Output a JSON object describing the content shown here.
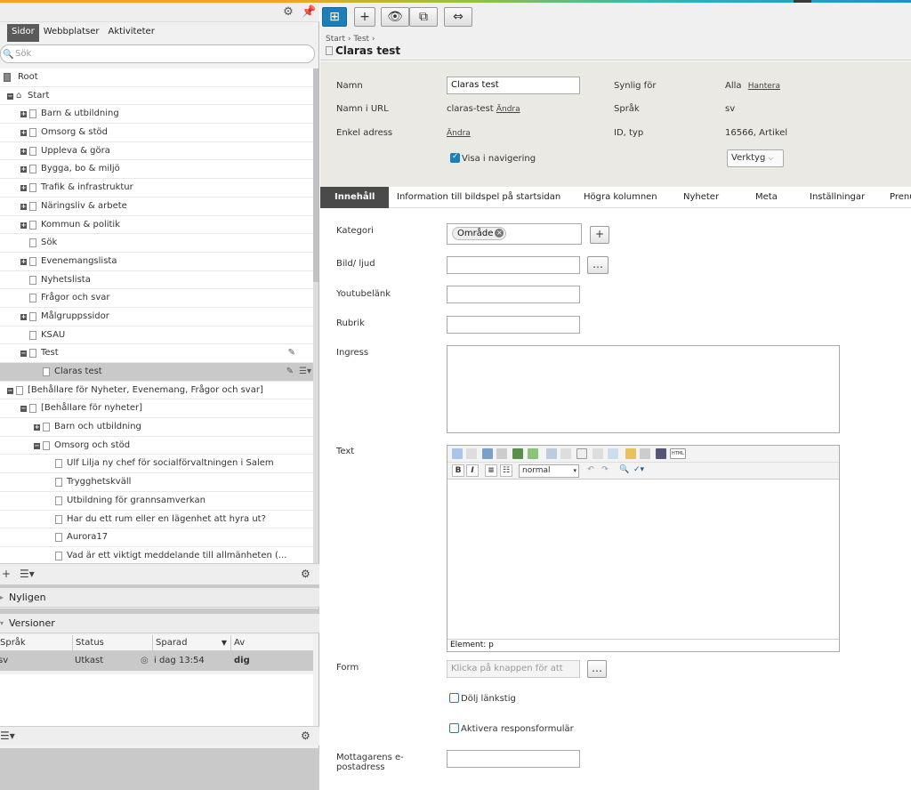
{
  "tree_panel": {
    "tabs": [
      "Sidor",
      "Webbplatser",
      "Aktiviteter"
    ],
    "search_placeholder": "Sök",
    "nodes": [
      {
        "label": "Root",
        "icon": "root-icon"
      },
      {
        "label": "Start",
        "icon": "home-icon"
      },
      {
        "label": "Barn & utbildning"
      },
      {
        "label": "Omsorg & stöd"
      },
      {
        "label": "Uppleva & göra"
      },
      {
        "label": "Bygga, bo & miljö"
      },
      {
        "label": "Trafik & infrastruktur"
      },
      {
        "label": "Näringsliv & arbete"
      },
      {
        "label": "Kommun & politik"
      },
      {
        "label": "Sök"
      },
      {
        "label": "Evenemangslista"
      },
      {
        "label": "Nyhetslista"
      },
      {
        "label": "Frågor och svar"
      },
      {
        "label": "Målgruppssidor"
      },
      {
        "label": "KSAU"
      },
      {
        "label": "Test"
      },
      {
        "label": "Claras test",
        "selected": true
      },
      {
        "label": "[Behållare för Nyheter, Evenemang, Frågor och svar]"
      },
      {
        "label": "[Behållare för nyheter]"
      },
      {
        "label": "Barn och utbildning"
      },
      {
        "label": "Omsorg och stöd"
      },
      {
        "label": "Ulf Lilja ny chef för socialförvaltningen i Salem"
      },
      {
        "label": "Trygghetskväll"
      },
      {
        "label": "Utbildning för grannsamverkan"
      },
      {
        "label": "Har du ett rum eller en lägenhet att hyra ut?"
      },
      {
        "label": "Aurora17"
      },
      {
        "label": "Vad är ett viktigt meddelande till allmänheten (..."
      }
    ]
  },
  "recent_panel": {
    "title": "Nyligen"
  },
  "versions_panel": {
    "title": "Versioner",
    "columns": [
      "Språk",
      "Status",
      "Sparad",
      "Av"
    ],
    "rows": [
      {
        "lang": "sv",
        "status": "Utkast",
        "saved": "i dag 13:54",
        "by": "dig"
      }
    ]
  },
  "breadcrumb": [
    "Start",
    "Test"
  ],
  "page_title": "Claras test",
  "properties": {
    "name_label": "Namn",
    "name_value": "Claras test",
    "url_label": "Namn i URL",
    "url_value": "claras-test",
    "change_link": "Ändra",
    "simple_label": "Enkel adress",
    "visible_label": "Synlig för",
    "visible_value": "Alla",
    "manage_link": "Hantera",
    "lang_label": "Språk",
    "lang_value": "sv",
    "id_label": "ID, typ",
    "id_value": "16566, Artikel",
    "show_in_nav": "Visa i navigering",
    "tools_button": "Verktyg"
  },
  "content_tabs": [
    "Innehåll",
    "Information till bildspel på startsidan",
    "Högra kolumnen",
    "Nyheter",
    "Meta",
    "Inställningar",
    "Prenu"
  ],
  "form": {
    "category_label": "Kategori",
    "category_chip": "Område",
    "media_label": "Bild/ ljud",
    "youtube_label": "Youtubelänk",
    "heading_label": "Rubrik",
    "ingress_label": "Ingress",
    "text_label": "Text",
    "editor_format": "normal",
    "editor_path": "Element: p",
    "form_label": "Form",
    "form_placeholder": "Klicka på knappen för att",
    "hide_link_trail": "Dölj länkstig",
    "activate_response": "Aktivera responsformulär",
    "recipient_label_1": "Mottagarens e-",
    "recipient_label_2": "postadress"
  },
  "colors": {
    "accent": "#1b7fb8",
    "selected_row": "#c9c9c9",
    "props_bg": "#eae9e4"
  }
}
